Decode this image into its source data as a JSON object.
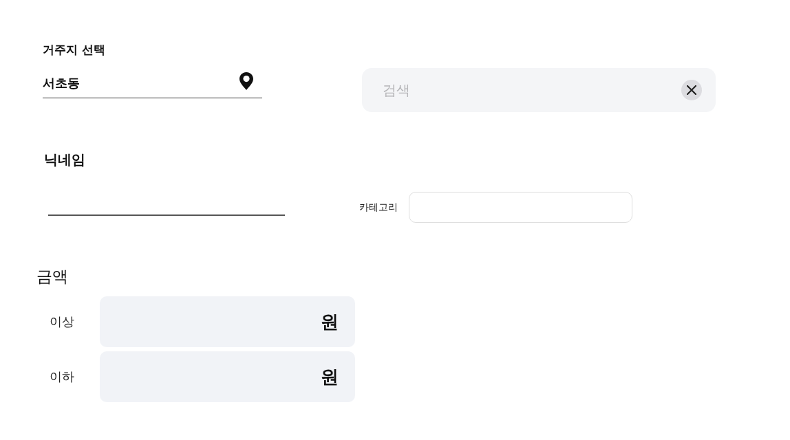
{
  "residence": {
    "label": "거주지 선택",
    "value": "서초동"
  },
  "search": {
    "placeholder": "검색"
  },
  "nickname": {
    "label": "닉네임"
  },
  "category": {
    "label": "카테고리"
  },
  "price": {
    "label": "금액",
    "ranges": [
      {
        "label": "이상",
        "unit": "원"
      },
      {
        "label": "이하",
        "unit": "원"
      }
    ]
  }
}
